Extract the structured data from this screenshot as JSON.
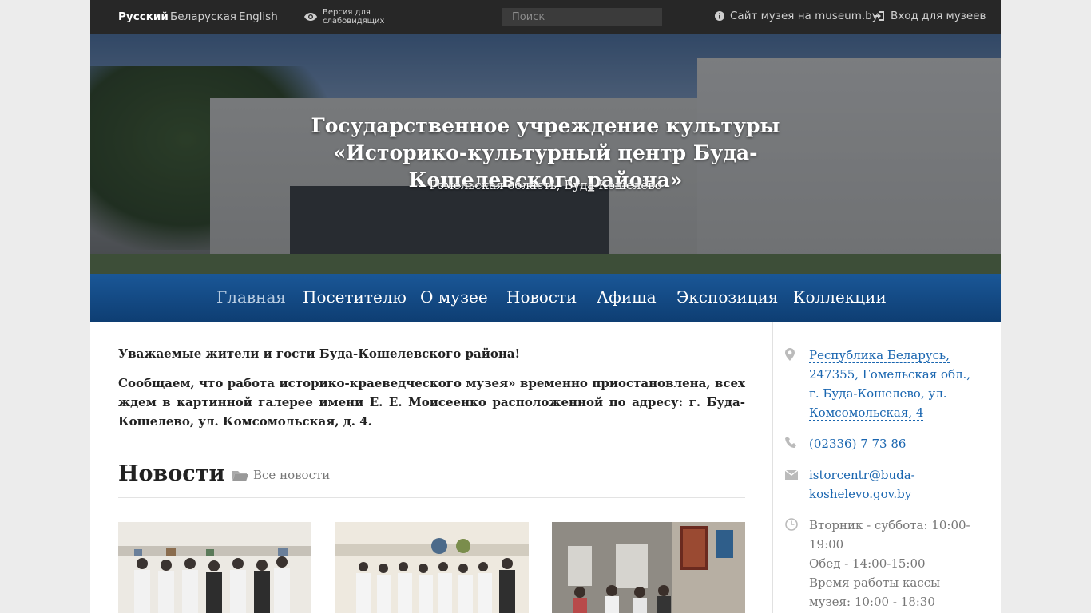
{
  "topbar": {
    "languages": [
      {
        "label": "Русский",
        "active": true
      },
      {
        "label": "Беларуская",
        "active": false
      },
      {
        "label": "English",
        "active": false
      }
    ],
    "low_vision_label": "Версия для слабовидящих",
    "search_placeholder": "Поиск",
    "museum_site_label": "Сайт музея на museum.by",
    "login_label": "Вход для музеев"
  },
  "hero": {
    "title": "Государственное учреждение культуры «Историко-культурный центр Буда-Кошелевского района»",
    "subtitle": "Гомельская область, Буда-Кошелёво"
  },
  "nav": {
    "items": [
      {
        "label": "Главная",
        "active": true
      },
      {
        "label": "Посетителю",
        "active": false
      },
      {
        "label": "О музее",
        "active": false
      },
      {
        "label": "Новости",
        "active": false
      },
      {
        "label": "Афиша",
        "active": false
      },
      {
        "label": "Экспозиция",
        "active": false
      },
      {
        "label": "Коллекции",
        "active": false
      }
    ]
  },
  "main": {
    "notice_title": "Уважаемые жители и гости Буда-Кошелевского района!",
    "notice_body": "Сообщаем, что работа историко-краеведческого музея» временно приостановлена, всех ждем в картинной галерее имени Е. Е. Моисеенко расположенной по адресу: г. Буда-Кошелево, ул. Комсомольская, д. 4.",
    "news_title": "Новости",
    "all_news_label": "Все новости"
  },
  "sidebar": {
    "address": "Республика Беларусь, 247355, Гомельская обл., г. Буда-Кошелево, ул. Комсомольская, 4",
    "phone": "(02336) 7 73 86",
    "email": "istorcentr@buda-koshelevo.gov.by",
    "hours_1": "Вторник - суббота: 10:00-19:00",
    "hours_2": "Обед - 14:00-15:00",
    "hours_3": "Время работы кассы музея: 10:00 - 18:30"
  },
  "colors": {
    "topbar_bg": "#272727",
    "nav_bg": "#14497f",
    "link": "#1a66b0"
  }
}
